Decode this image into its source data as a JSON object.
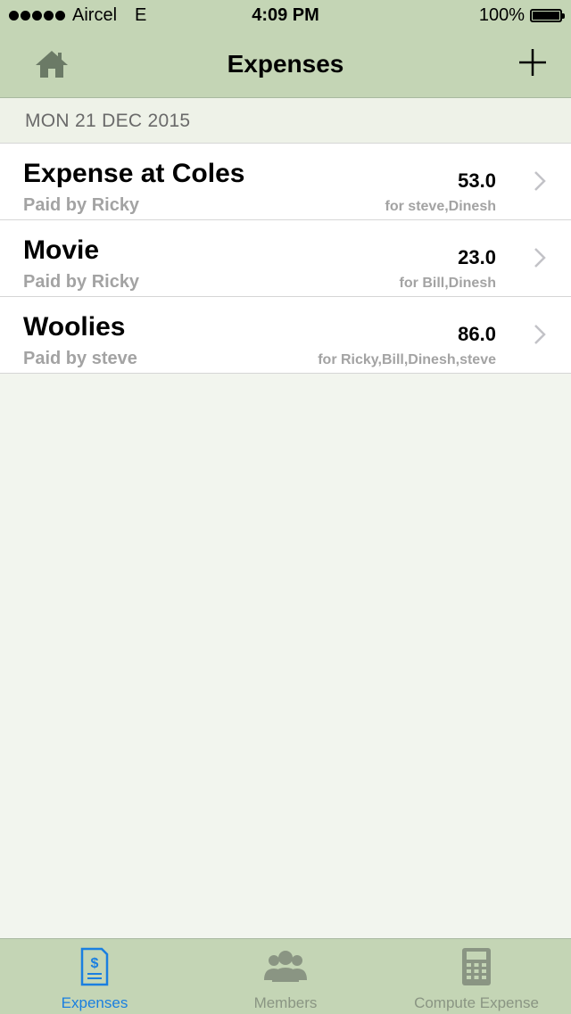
{
  "status": {
    "carrier": "Aircel",
    "network": "E",
    "time": "4:09 PM",
    "battery": "100%"
  },
  "nav": {
    "title": "Expenses",
    "home_icon": "home-icon",
    "add_icon": "plus-icon"
  },
  "section": {
    "date": "MON 21 DEC 2015"
  },
  "expenses": [
    {
      "name": "Expense at Coles",
      "paid_by": "Paid by Ricky",
      "amount": "53.0",
      "for": "for steve,Dinesh"
    },
    {
      "name": "Movie",
      "paid_by": "Paid by Ricky",
      "amount": "23.0",
      "for": "for Bill,Dinesh"
    },
    {
      "name": "Woolies",
      "paid_by": "Paid by steve",
      "amount": "86.0",
      "for": "for Ricky,Bill,Dinesh,steve"
    }
  ],
  "tabs": [
    {
      "label": "Expenses",
      "icon": "receipt-icon",
      "active": true
    },
    {
      "label": "Members",
      "icon": "members-icon",
      "active": false
    },
    {
      "label": "Compute Expense",
      "icon": "calculator-icon",
      "active": false
    }
  ],
  "colors": {
    "bar": "#c4d5b5",
    "background": "#f2f5ee",
    "active_tab": "#1a7fe0",
    "inactive_tab": "#8a9583"
  }
}
